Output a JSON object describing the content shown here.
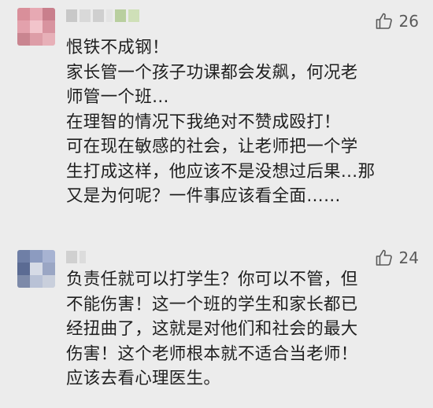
{
  "colors": {
    "background": "#ececec",
    "text": "#1f1f1f",
    "like": "#5a5a5a"
  },
  "comments": [
    {
      "like_icon": "thumbs-up-icon",
      "like_count": "26",
      "lines": [
        "恨铁不成钢！",
        "家长管一个孩子功课都会发飙，何况老",
        "师管一个班…",
        "在理智的情况下我绝对不赞成殴打！",
        "可在现在敏感的社会，让老师把一个学",
        "生打成这样，他应该不是没想过后果…那",
        "又是为何呢？一件事应该看全面……"
      ]
    },
    {
      "like_icon": "thumbs-up-icon",
      "like_count": "24",
      "lines": [
        "负责任就可以打学生？你可以不管，但",
        "不能伤害！这一个班的学生和家长都已",
        "经扭曲了，这就是对他们和社会的最大",
        "伤害！这个老师根本就不适合当老师！",
        "应该去看心理医生。"
      ]
    }
  ]
}
